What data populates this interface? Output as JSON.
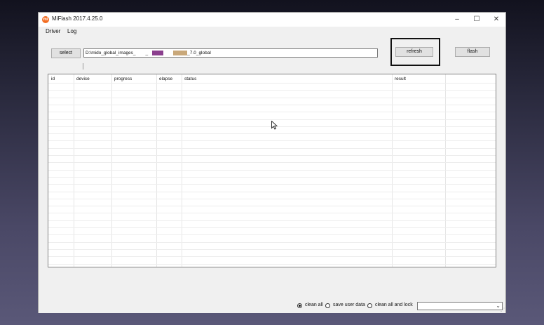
{
  "window": {
    "title": "MiFlash 2017.4.25.0",
    "app_icon_text": "mi",
    "minimize": "–",
    "maximize": "☐",
    "close": "✕"
  },
  "menu": {
    "items": [
      "Driver",
      "Log"
    ]
  },
  "toolbar": {
    "select_label": "select",
    "path_prefix": "D:\\mido_global_images_",
    "path_mid": "_",
    "path_suffix": "_7.0_global",
    "refresh_label": "refresh",
    "flash_label": "flash"
  },
  "grid": {
    "columns": [
      "id",
      "device",
      "progress",
      "elapse",
      "status",
      "result"
    ]
  },
  "bottom": {
    "options": [
      "clean all",
      "save user data",
      "clean all and lock"
    ],
    "selected": "clean all",
    "dropdown_value": ""
  },
  "colors": {
    "accent_icon": "#f36c21",
    "highlight_border": "#111111",
    "redaction_purple": "#8b3f8e",
    "redaction_tan": "#c9a87a"
  }
}
